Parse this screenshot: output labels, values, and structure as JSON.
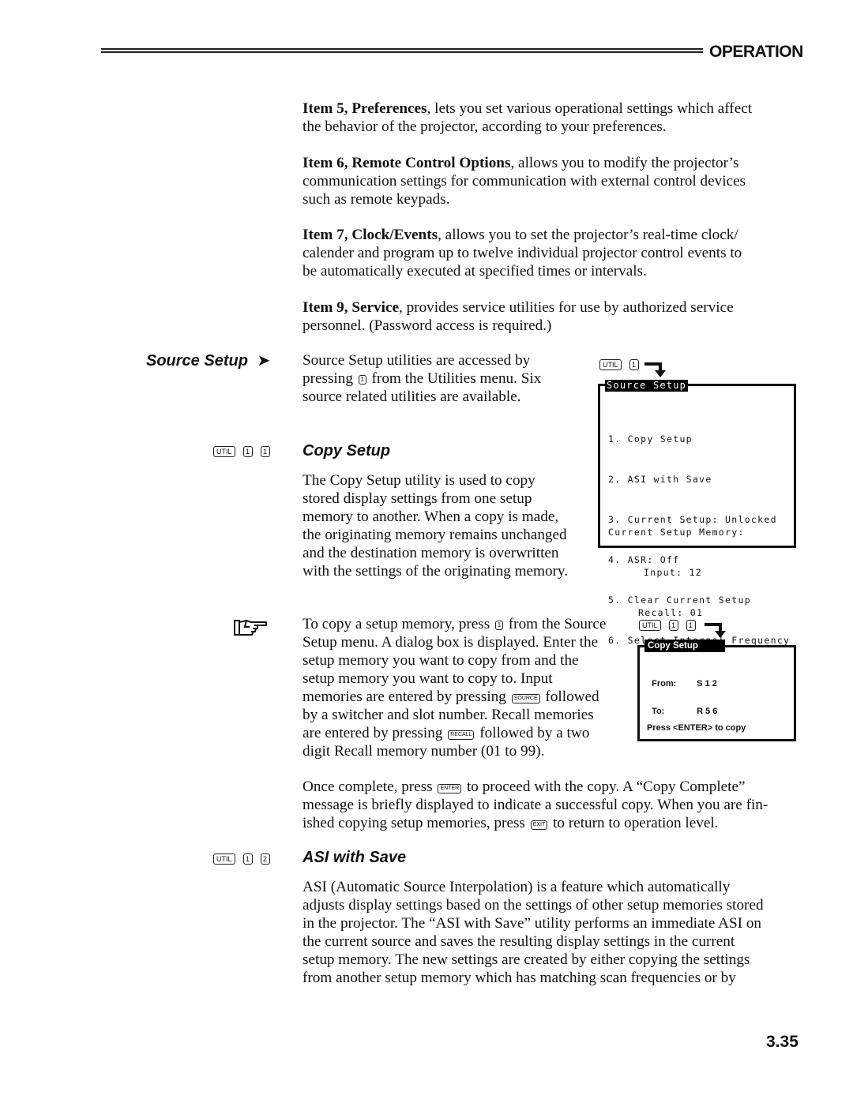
{
  "header": {
    "section_title": "OPERATION"
  },
  "intro_items": [
    {
      "lead": "Item 5, Preferences",
      "lines": [
        "Item 5, Preferences, lets you set various operational settings which affect",
        "the behavior of the projector, according to your preferences."
      ],
      "rest1": ", lets you set various operational settings which affect",
      "rest2": "the behavior of the projector, according to your preferences."
    },
    {
      "lead": "Item 6, Remote Control Options",
      "rest1": ", allows you to modify the projector’s",
      "rest2": "communication settings for communication with external control devices",
      "rest3": "such as remote keypads."
    },
    {
      "lead": "Item 7, Clock/Events",
      "rest1": ", allows you to set the projector’s real-time clock/",
      "rest2": "calender and program up to twelve individual projector control events to",
      "rest3": "be automatically executed at specified times or intervals."
    },
    {
      "lead": "Item 9, Service",
      "rest1": ", provides service utilities for use by authorized service",
      "rest2": "personnel. (Password access is required.)"
    }
  ],
  "source_setup": {
    "side_heading": "Source Setup",
    "arrow_glyph": "➤",
    "line1": "Source Setup utilities are accessed by",
    "line2a": "pressing",
    "line2_key": "1",
    "line2b": "from the Utilities menu. Six",
    "line3": "source related utilities are available."
  },
  "menu_screen": {
    "key_sequence": [
      "UTIL",
      "1"
    ],
    "title": "Source Setup",
    "items": [
      "1. Copy Setup",
      "2. ASI with Save",
      "3. Current Setup: Unlocked",
      "4. ASR: Off",
      "5. Clear Current Setup",
      "6. Select Internal Frequency"
    ],
    "memory_label": "Current Setup Memory:",
    "input_line": "Input: 12",
    "recall_line": "Recall: 01"
  },
  "copy_setup": {
    "key_sequence": [
      "UTIL",
      "1",
      "1"
    ],
    "heading": "Copy Setup",
    "paragraph": [
      "The Copy Setup utility is used to copy",
      "stored display settings from one setup",
      "memory to another. When a copy is made,",
      "the originating memory remains unchanged",
      "and the destination memory is overwritten",
      "with the settings of the originating memory."
    ],
    "tip_lines": {
      "l1a": "To copy a setup memory, press",
      "l1_key": "1",
      "l1b": "from the Source",
      "l2": "Setup menu. A dialog box is displayed. Enter the",
      "l3": "setup memory you want to copy from and the",
      "l4": "setup memory you want to copy to. Input",
      "l5a": "memories are entered by pressing",
      "l5_key": "SOURCE",
      "l5b": "followed",
      "l6": "by a switcher and slot number. Recall memories",
      "l7a": "are entered by pressing",
      "l7_key": "RECALL",
      "l7b": "followed by a two",
      "l8": "digit Recall memory number (01 to 99)."
    },
    "complete_lines": {
      "l1a": "Once complete, press",
      "l1_key": "ENTER",
      "l1b": "to proceed with the copy. A “Copy Complete”",
      "l2": "message is briefly displayed to indicate a successful copy. When you are fin-",
      "l3a": "ished copying setup memories, press",
      "l3_key": "EXIT",
      "l3b": "to return to operation level."
    }
  },
  "copy_dialog": {
    "key_sequence": [
      "UTIL",
      "1",
      "1"
    ],
    "title": "Copy Setup",
    "from_label": "From:",
    "from_value": "S 1 2",
    "to_label": "To:",
    "to_value": "R 5 6",
    "prompt": "Press <ENTER> to copy"
  },
  "asi_with_save": {
    "key_sequence": [
      "UTIL",
      "1",
      "2"
    ],
    "heading": "ASI with Save",
    "paragraph": [
      "ASI (Automatic Source Interpolation) is a feature which automatically",
      "adjusts display settings based on the settings of other setup memories stored",
      "in the projector. The “ASI with Save” utility performs an immediate ASI on",
      "the current source and saves the resulting display settings in the current",
      "setup memory. The new settings are created by either copying the settings",
      "from another setup memory which has matching scan frequencies or by"
    ]
  },
  "footer": {
    "page_number": "3.35"
  }
}
